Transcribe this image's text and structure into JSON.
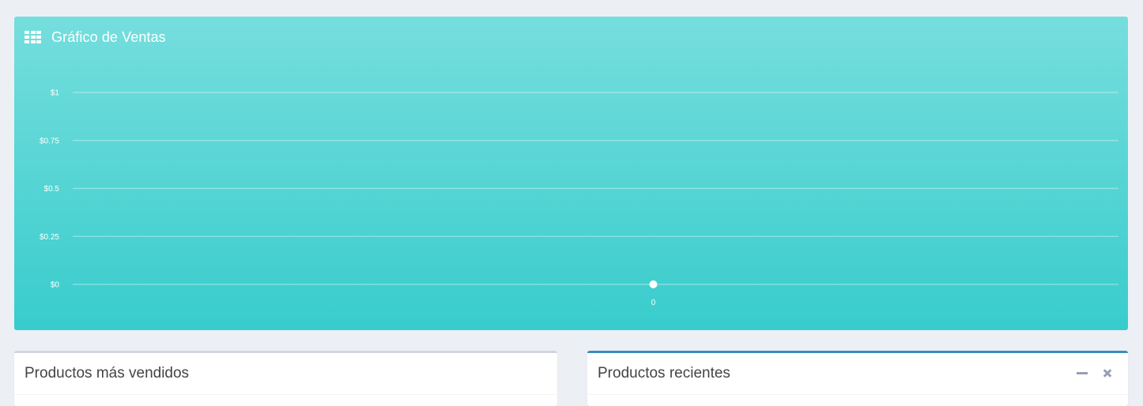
{
  "sales_chart": {
    "title": "Gráfico de Ventas",
    "icon": "table-grid-icon",
    "colors": {
      "background_top": "#75dedd",
      "background_bottom": "#39cccc",
      "text": "#ffffff"
    },
    "chart_data": {
      "type": "line",
      "title": "Gráfico de Ventas",
      "xlabel": "",
      "ylabel": "",
      "x": [
        "0"
      ],
      "series": [
        {
          "values": [
            0
          ]
        }
      ],
      "ylim": [
        0,
        1
      ],
      "y_ticks": [
        0,
        0.25,
        0.5,
        0.75,
        1
      ],
      "y_tick_labels": [
        "$0",
        "$0.25",
        "$0.5",
        "$0.75",
        "$1"
      ],
      "x_tick_labels": [
        "0"
      ],
      "grid": true,
      "legend": "none"
    }
  },
  "top_products_box": {
    "title": "Productos más vendidos"
  },
  "recent_products_box": {
    "title": "Productos recientes",
    "accent": "#3c8dbc",
    "tools": {
      "collapse_icon": "minus-icon",
      "remove_icon": "times-icon"
    }
  }
}
